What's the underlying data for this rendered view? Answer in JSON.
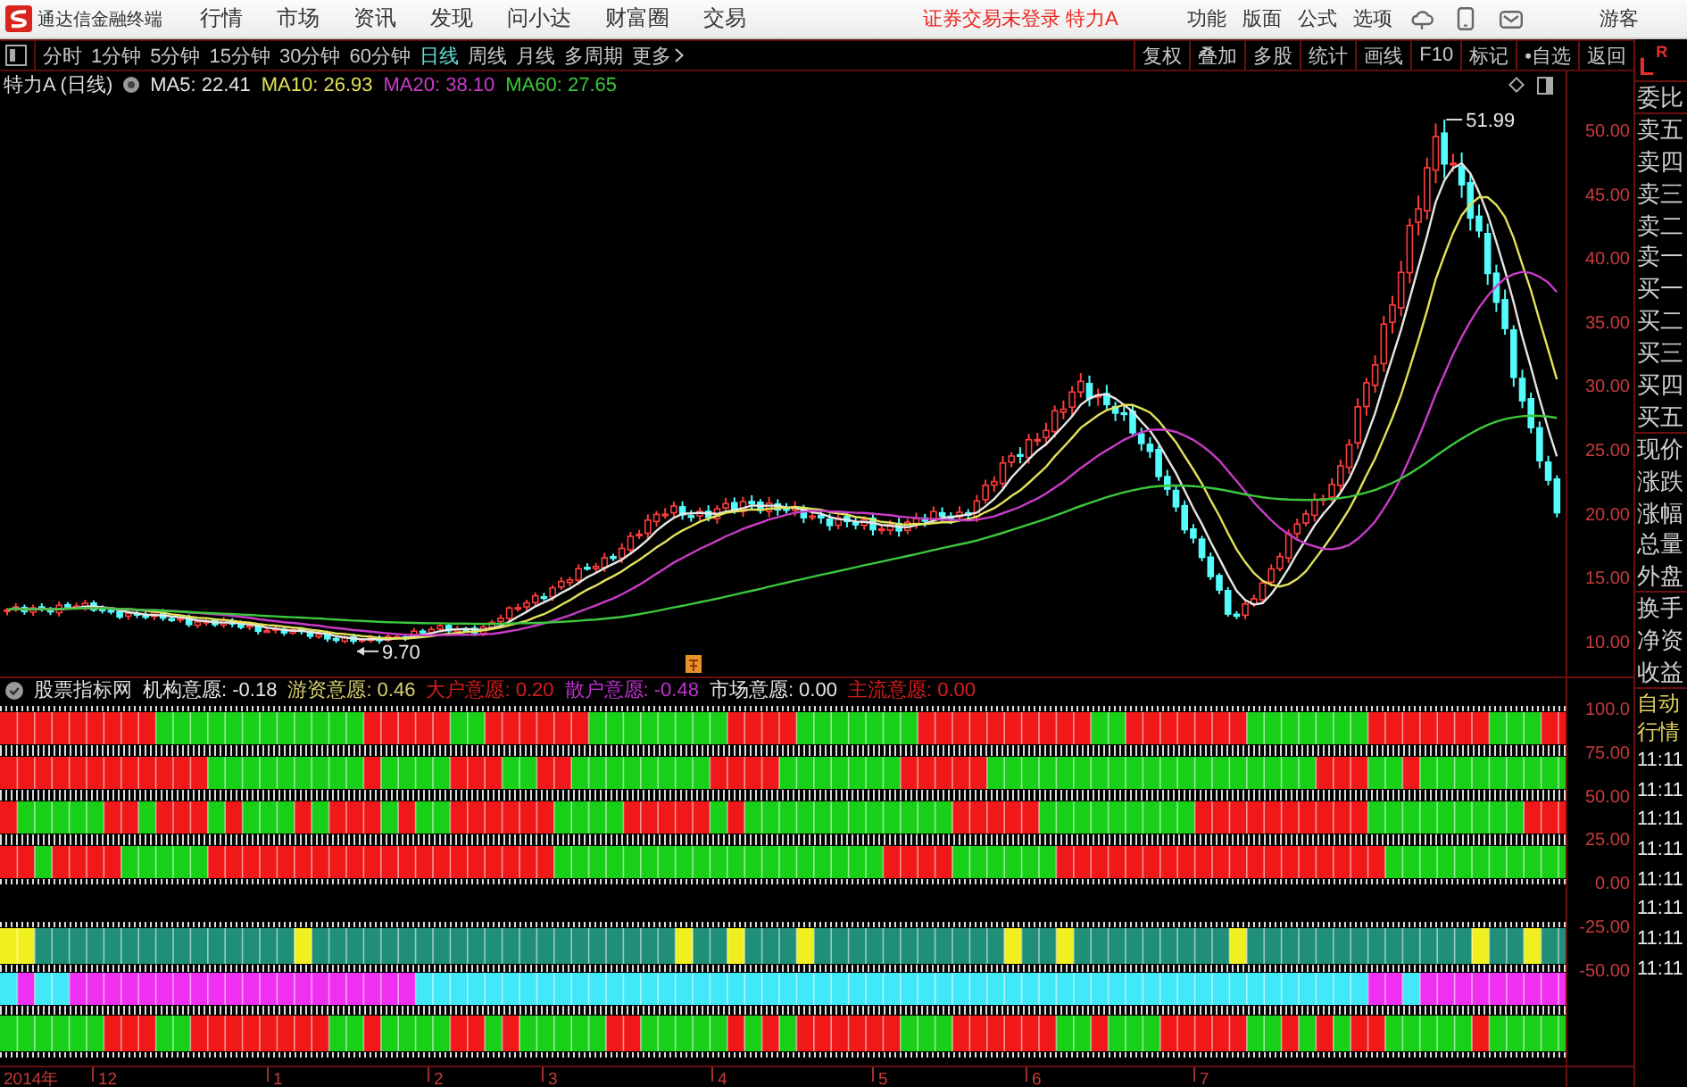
{
  "title_bar": {
    "app_name": "通达信金融终端",
    "menu": [
      "行情",
      "市场",
      "资讯",
      "发现",
      "问小达",
      "财富圈",
      "交易"
    ],
    "status": "证券交易未登录 特力A",
    "tools": [
      "功能",
      "版面",
      "公式",
      "选项"
    ],
    "user": "游客"
  },
  "period_bar": {
    "tabs": [
      {
        "label": "分时",
        "selected": false
      },
      {
        "label": "1分钟",
        "selected": false
      },
      {
        "label": "5分钟",
        "selected": false
      },
      {
        "label": "15分钟",
        "selected": false
      },
      {
        "label": "30分钟",
        "selected": false
      },
      {
        "label": "60分钟",
        "selected": false
      },
      {
        "label": "日线",
        "selected": true
      },
      {
        "label": "周线",
        "selected": false
      },
      {
        "label": "月线",
        "selected": false
      },
      {
        "label": "多周期",
        "selected": false
      }
    ],
    "more": "更多",
    "actions": [
      "复权",
      "叠加",
      "多股",
      "统计",
      "画线",
      "F10",
      "标记",
      "•自选",
      "返回"
    ]
  },
  "price_chart": {
    "title": "特力A (日线)",
    "moving_averages": [
      {
        "label": "MA5: 22.41",
        "color": "#e6e6e6"
      },
      {
        "label": "MA10: 26.93",
        "color": "#e2e25a"
      },
      {
        "label": "MA20: 38.10",
        "color": "#c83cc8"
      },
      {
        "label": "MA60: 27.65",
        "color": "#3cc83c"
      }
    ],
    "high_label": "51.99",
    "low_label": "9.70",
    "y_axis": [
      "50.00",
      "45.00",
      "40.00",
      "35.00",
      "30.00",
      "25.00",
      "20.00",
      "15.00",
      "10.00"
    ]
  },
  "indicator": {
    "source": "股票指标网",
    "series": [
      {
        "label": "机构意愿: -0.18",
        "color": "#e6e6e6"
      },
      {
        "label": "游资意愿: 0.46",
        "color": "#d8d070"
      },
      {
        "label": "大户意愿: 0.20",
        "color": "#d81c1c"
      },
      {
        "label": "散户意愿: -0.48",
        "color": "#c030d0"
      },
      {
        "label": "市场意愿: 0.00",
        "color": "#e6e6e6"
      },
      {
        "label": "主流意愿: 0.00",
        "color": "#d81c1c"
      }
    ],
    "y_axis": [
      "100.0",
      "75.00",
      "50.00",
      "25.00",
      "0.00",
      "-25.00",
      "-50.00"
    ]
  },
  "date_axis": [
    "2014年",
    "12",
    "1",
    "2",
    "3",
    "4",
    "5",
    "6",
    "7"
  ],
  "quote_panel": {
    "mode_buttons": [
      "L",
      "R"
    ],
    "fields": [
      "委比",
      "卖五",
      "卖四",
      "卖三",
      "卖二",
      "卖一",
      "买一",
      "买二",
      "买三",
      "买四",
      "买五",
      "现价",
      "涨跌",
      "涨幅",
      "总量",
      "外盘",
      "换手",
      "净资",
      "收益"
    ],
    "refresh": [
      "自动",
      "行情"
    ],
    "times": [
      "11:11",
      "11:11",
      "11:11",
      "11:11",
      "11:11",
      "11:11",
      "11:11",
      "11:11"
    ]
  }
}
